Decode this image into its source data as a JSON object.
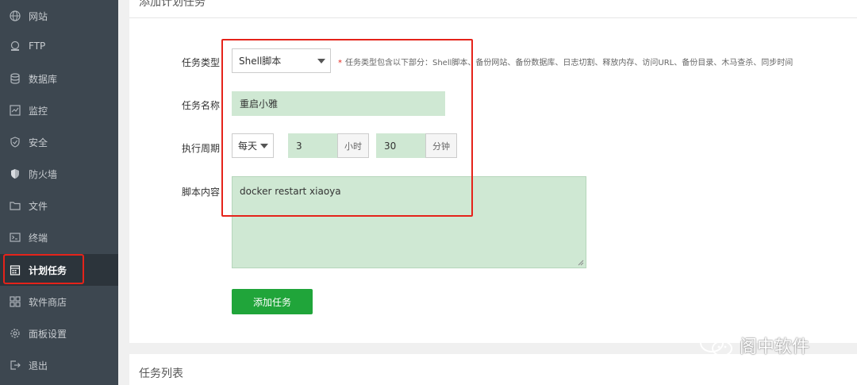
{
  "sidebar": {
    "items": [
      {
        "label": "网站",
        "icon": "globe-icon"
      },
      {
        "label": "FTP",
        "icon": "ftp-icon"
      },
      {
        "label": "数据库",
        "icon": "database-icon"
      },
      {
        "label": "监控",
        "icon": "monitor-icon"
      },
      {
        "label": "安全",
        "icon": "shield-icon"
      },
      {
        "label": "防火墙",
        "icon": "firewall-icon"
      },
      {
        "label": "文件",
        "icon": "folder-icon"
      },
      {
        "label": "终端",
        "icon": "terminal-icon"
      },
      {
        "label": "计划任务",
        "icon": "calendar-icon",
        "active": true
      },
      {
        "label": "软件商店",
        "icon": "apps-icon"
      },
      {
        "label": "面板设置",
        "icon": "gear-icon"
      },
      {
        "label": "退出",
        "icon": "logout-icon"
      }
    ]
  },
  "form": {
    "title": "添加计划任务",
    "type_label": "任务类型",
    "type_value": "Shell脚本",
    "type_hint_star": "*",
    "type_hint": "任务类型包含以下部分：Shell脚本、备份网站、备份数据库、日志切割、释放内存、访问URL、备份目录、木马查杀、同步时间",
    "name_label": "任务名称",
    "name_value": "重启小雅",
    "period_label": "执行周期",
    "period_value": "每天",
    "hour_value": "3",
    "hour_unit": "小时",
    "minute_value": "30",
    "minute_unit": "分钟",
    "script_label": "脚本内容",
    "script_value": "docker restart xiaoya",
    "add_button": "添加任务"
  },
  "list": {
    "title": "任务列表"
  },
  "watermark": "阁中软件",
  "colors": {
    "sidebar_bg": "#3d4750",
    "accent_green": "#20a53a",
    "highlight_red": "#e5231a",
    "input_green": "#cfe8d3"
  }
}
